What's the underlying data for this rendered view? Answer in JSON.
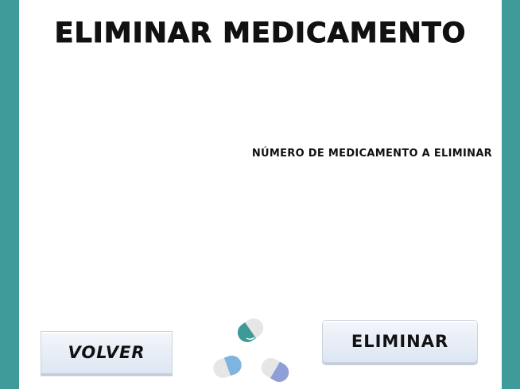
{
  "header": {
    "title": "ELIMINAR MEDICAMENTO"
  },
  "form": {
    "number_label": "NÚMERO DE MEDICAMENTO A ELIMINAR"
  },
  "actions": {
    "back_label": "VOLVER",
    "delete_label": "ELIMINAR"
  },
  "decoration": {
    "icon": "pills-icon"
  },
  "colors": {
    "frame": "#3f9a9a",
    "panel": "#ffffff",
    "pill_teal": "#3d9a96",
    "pill_blue": "#7fb3e0",
    "pill_periwinkle": "#8e9fd6",
    "pill_grey": "#e6e6e6"
  }
}
